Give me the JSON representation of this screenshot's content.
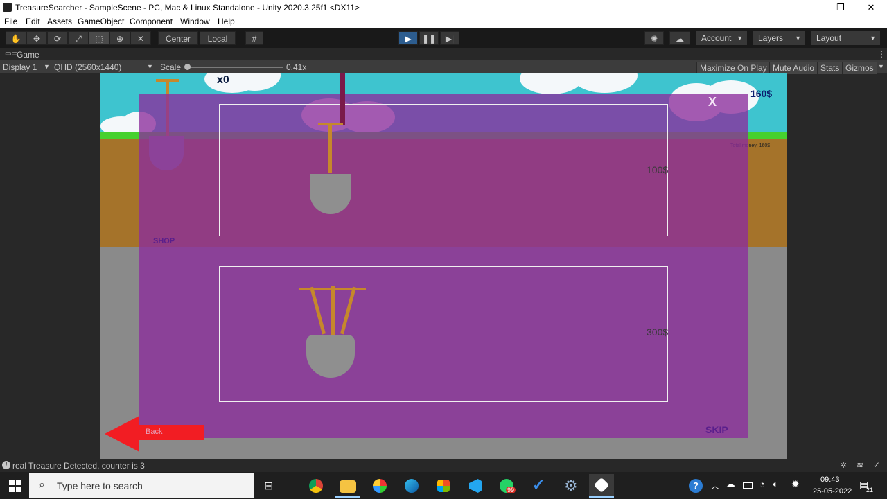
{
  "window": {
    "title": "TreasureSearcher - SampleScene - PC, Mac & Linux Standalone - Unity 2020.3.25f1 <DX11>",
    "minimize": "—",
    "restore": "❐",
    "close": "✕"
  },
  "menu": [
    "File",
    "Edit",
    "Assets",
    "GameObject",
    "Component",
    "Window",
    "Help"
  ],
  "toolbar": {
    "center_label": "Center",
    "local_label": "Local",
    "account_label": "Account",
    "layers_label": "Layers",
    "layout_label": "Layout"
  },
  "game_tab": {
    "label": "Game"
  },
  "game_bar": {
    "display": "Display 1",
    "resolution": "QHD (2560x1440)",
    "scale_label": "Scale",
    "scale_value": "0.41x",
    "maximize": "Maximize On Play",
    "mute": "Mute Audio",
    "stats": "Stats",
    "gizmos": "Gizmos"
  },
  "game": {
    "counter": "x0",
    "money": "160$",
    "total_money": "Total money: 160$",
    "shop_label": "SHOP",
    "close_label": "X",
    "item1_price": "100$",
    "item2_price": "300$",
    "back_label": "Back",
    "skip_label": "SKIP"
  },
  "status_bar": {
    "message": "real Treasure Detected, counter is 3"
  },
  "taskbar": {
    "search_placeholder": "Type here to search",
    "whatsapp_badge": "99",
    "time": "09:43",
    "date": "25-05-2022",
    "notif_count": "21"
  },
  "colors": {
    "sky": "#3ec4cf",
    "grass": "#46d12e",
    "dirt": "#a5732a",
    "overlay": "#8c2d9c",
    "back_arrow": "#f21d23",
    "play_active": "#2d5d8f"
  }
}
